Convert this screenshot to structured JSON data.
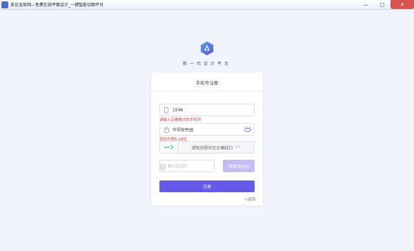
{
  "window": {
    "title": "亚论龙官网—免费在线平面设计_一键智能切图平台",
    "minimize": "—",
    "maximize": "□",
    "close": "✕"
  },
  "brand": {
    "slogan": "新一代设计平台",
    "accent_color": "#6658e8"
  },
  "card": {
    "title": "手机号注册",
    "phone": {
      "value": "1546",
      "error": "请输入正确格式的手机号"
    },
    "password": {
      "value": "华军软件园",
      "error": "密码长度6-16位"
    },
    "slider": {
      "text": "请拖动滑块至正确缺口",
      "arrows": ">>"
    },
    "code": {
      "placeholder": "输入验证码",
      "button": "获取验证码"
    },
    "register_button": "注册",
    "back_link": "<返回"
  }
}
